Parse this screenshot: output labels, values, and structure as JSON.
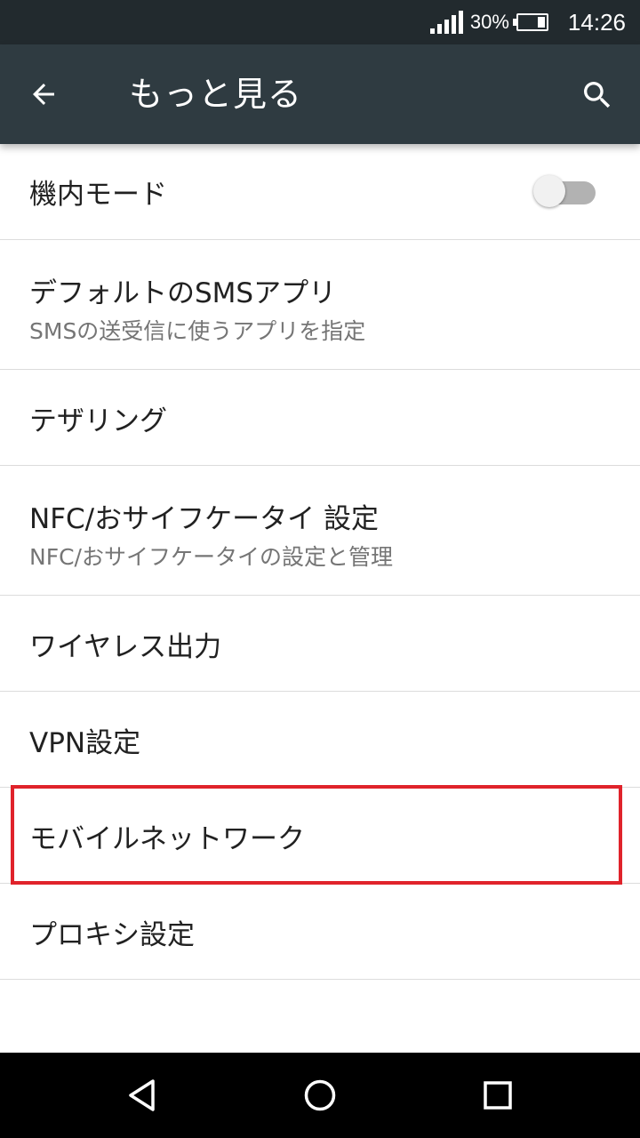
{
  "status_bar": {
    "battery_percent": "30%",
    "battery_level": 0.3,
    "time": "14:26",
    "icons": [
      "signal-icon",
      "battery-icon"
    ]
  },
  "app_bar": {
    "title": "もっと見る",
    "icons": [
      "back-arrow-icon",
      "search-icon"
    ]
  },
  "settings": {
    "airplane_mode": {
      "label": "機内モード",
      "enabled": false
    },
    "default_sms": {
      "label": "デフォルトのSMSアプリ",
      "summary": "SMSの送受信に使うアプリを指定"
    },
    "tethering": {
      "label": "テザリング"
    },
    "nfc": {
      "label": "NFC/おサイフケータイ 設定",
      "summary": "NFC/おサイフケータイの設定と管理"
    },
    "wireless_display": {
      "label": "ワイヤレス出力"
    },
    "vpn": {
      "label": "VPN設定"
    },
    "mobile_network": {
      "label": "モバイルネットワーク",
      "highlighted": true
    },
    "proxy": {
      "label": "プロキシ設定"
    }
  },
  "nav_bar": {
    "icons": [
      "back-triangle-icon",
      "home-circle-icon",
      "recents-square-icon"
    ]
  },
  "colors": {
    "status_bar": "#222a2e",
    "app_bar": "#2f3b41",
    "highlight": "#e0232b",
    "divider": "#dcdcdc",
    "text_primary": "#212121",
    "text_secondary": "#757575"
  }
}
